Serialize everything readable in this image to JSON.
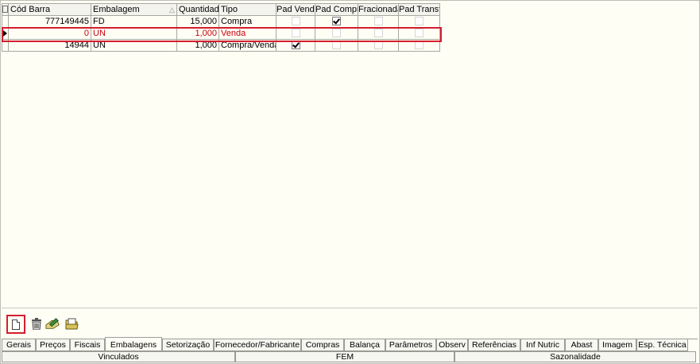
{
  "columns": {
    "cod_barra": "Cód Barra",
    "embalagem": "Embalagem",
    "quantidade": "Quantidade",
    "tipo": "Tipo",
    "pad_venda": "Pad Venda",
    "pad_compra": "Pad Compra",
    "fracionada": "Fracionada",
    "pad_transf": "Pad Transf."
  },
  "rows": [
    {
      "cod_barra": "777149445",
      "embalagem": "FD",
      "quantidade": "15,000",
      "tipo": "Compra",
      "pad_venda": false,
      "pad_compra": true,
      "fracionada": false,
      "pad_transf": false
    },
    {
      "cod_barra": "0",
      "embalagem": "UN",
      "quantidade": "1,000",
      "tipo": "Venda",
      "pad_venda": false,
      "pad_compra": false,
      "fracionada": false,
      "pad_transf": false
    },
    {
      "cod_barra": "14944",
      "embalagem": "UN",
      "quantidade": "1,000",
      "tipo": "Compra/Venda",
      "pad_venda": true,
      "pad_compra": false,
      "fracionada": false,
      "pad_transf": false
    }
  ],
  "selected_row": 1,
  "tabs": [
    "Gerais",
    "Preços",
    "Fiscais",
    "Embalagens",
    "Setorização",
    "Fornecedor/Fabricante",
    "Compras",
    "Balança",
    "Parâmetros",
    "Observ",
    "Referências",
    "Inf Nutric",
    "Abast",
    "Imagem",
    "Esp. Técnica"
  ],
  "active_tab": "Embalagens",
  "subtabs": [
    "Vinculados",
    "FEM",
    "Sazonalidade"
  ],
  "toolbar": {
    "icons": [
      "new-document-icon",
      "trash-icon",
      "edit-icon",
      "open-folder-icon"
    ]
  },
  "colors": {
    "highlight": "#d41e2d",
    "selected_text": "#c8000a"
  }
}
